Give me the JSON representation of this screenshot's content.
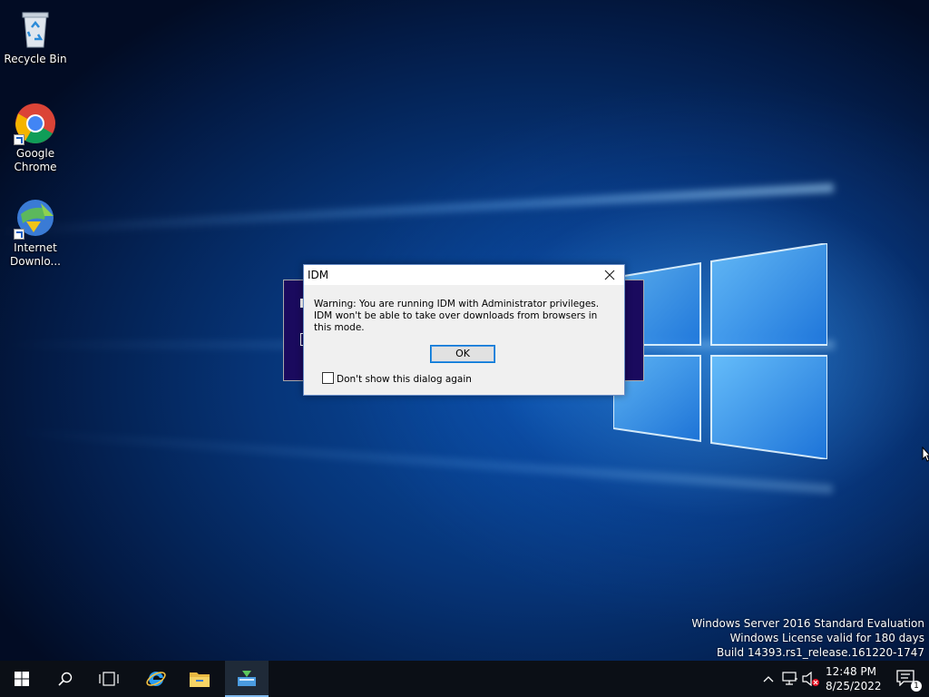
{
  "desktop": {
    "icons": [
      {
        "label": "Recycle Bin"
      },
      {
        "label": "Google Chrome"
      },
      {
        "label": "Internet Downlo..."
      }
    ]
  },
  "dialog": {
    "title": "IDM",
    "message_line1": "Warning: You are running IDM with Administrator privileges.",
    "message_line2": "IDM won't be able to take over downloads from browsers in this mode.",
    "ok_label": "OK",
    "checkbox_label": "Don't show this dialog again",
    "checkbox_checked": false
  },
  "watermark": {
    "line1": "Windows Server 2016 Standard Evaluation",
    "line2": "Windows License valid for 180 days",
    "line3": "Build 14393.rs1_release.161220-1747"
  },
  "taskbar": {
    "buttons": [
      "start-icon",
      "search-icon",
      "task-view-icon",
      "internet-explorer-icon",
      "file-explorer-icon",
      "idm-app-icon"
    ],
    "clock_time": "12:48 PM",
    "clock_date": "8/25/2022",
    "notification_count": "1"
  },
  "colors": {
    "taskbar": "#0b0f16",
    "dialog_bg": "#f0f0f0",
    "accent": "#0078d7"
  }
}
